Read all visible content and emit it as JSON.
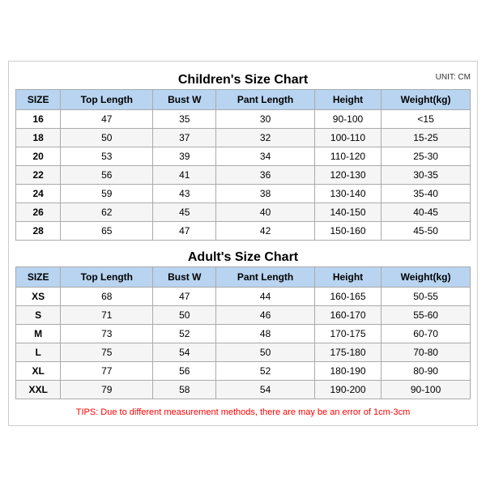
{
  "children_title": "Children's Size Chart",
  "adult_title": "Adult's Size Chart",
  "unit_label": "UNIT: CM",
  "children_headers": [
    "SIZE",
    "Top Length",
    "Bust W",
    "Pant Length",
    "Height",
    "Weight(kg)"
  ],
  "children_rows": [
    [
      "16",
      "47",
      "35",
      "30",
      "90-100",
      "<15"
    ],
    [
      "18",
      "50",
      "37",
      "32",
      "100-110",
      "15-25"
    ],
    [
      "20",
      "53",
      "39",
      "34",
      "110-120",
      "25-30"
    ],
    [
      "22",
      "56",
      "41",
      "36",
      "120-130",
      "30-35"
    ],
    [
      "24",
      "59",
      "43",
      "38",
      "130-140",
      "35-40"
    ],
    [
      "26",
      "62",
      "45",
      "40",
      "140-150",
      "40-45"
    ],
    [
      "28",
      "65",
      "47",
      "42",
      "150-160",
      "45-50"
    ]
  ],
  "adult_headers": [
    "SIZE",
    "Top Length",
    "Bust W",
    "Pant Length",
    "Height",
    "Weight(kg)"
  ],
  "adult_rows": [
    [
      "XS",
      "68",
      "47",
      "44",
      "160-165",
      "50-55"
    ],
    [
      "S",
      "71",
      "50",
      "46",
      "160-170",
      "55-60"
    ],
    [
      "M",
      "73",
      "52",
      "48",
      "170-175",
      "60-70"
    ],
    [
      "L",
      "75",
      "54",
      "50",
      "175-180",
      "70-80"
    ],
    [
      "XL",
      "77",
      "56",
      "52",
      "180-190",
      "80-90"
    ],
    [
      "XXL",
      "79",
      "58",
      "54",
      "190-200",
      "90-100"
    ]
  ],
  "tips": "TIPS: Due to different measurement methods, there are may be an error of 1cm-3cm"
}
